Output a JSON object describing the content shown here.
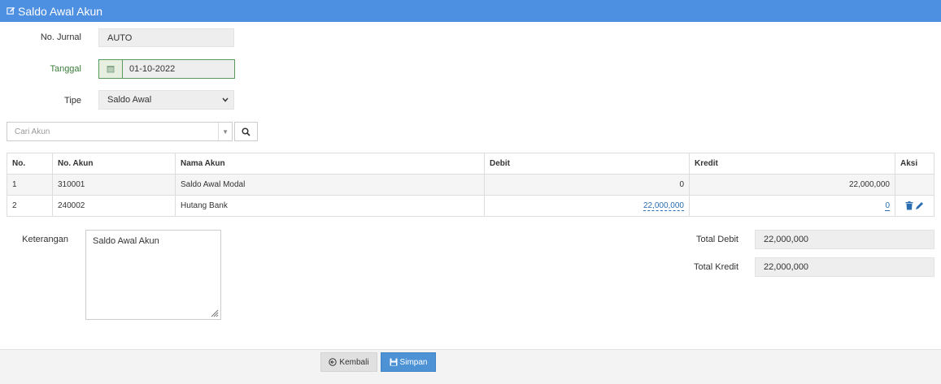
{
  "header": {
    "title": "Saldo Awal Akun",
    "icon": "edit-icon"
  },
  "form": {
    "no_jurnal_label": "No. Jurnal",
    "no_jurnal_value": "AUTO",
    "tanggal_label": "Tanggal",
    "tanggal_value": "01-10-2022",
    "tipe_label": "Tipe",
    "tipe_value": "Saldo Awal",
    "search_placeholder": "Cari Akun"
  },
  "table": {
    "headers": [
      "No.",
      "No. Akun",
      "Nama Akun",
      "Debit",
      "Kredit",
      "Aksi"
    ],
    "rows": [
      {
        "no": "1",
        "akun": "310001",
        "nama": "Saldo Awal Modal",
        "debit": "0",
        "kredit": "22,000,000"
      },
      {
        "no": "2",
        "akun": "240002",
        "nama": "Hutang Bank",
        "debit": "22,000,000",
        "kredit": "0"
      }
    ]
  },
  "keterangan": {
    "label": "Keterangan",
    "value": "Saldo Awal Akun"
  },
  "totals": {
    "debit_label": "Total Debit",
    "debit_value": "22,000,000",
    "kredit_label": "Total Kredit",
    "kredit_value": "22,000,000"
  },
  "buttons": {
    "back": "Kembali",
    "save": "Simpan"
  },
  "colors": {
    "header": "#4d8fe0",
    "accent_green": "#3a7d3a",
    "save_button": "#4c92d4"
  }
}
